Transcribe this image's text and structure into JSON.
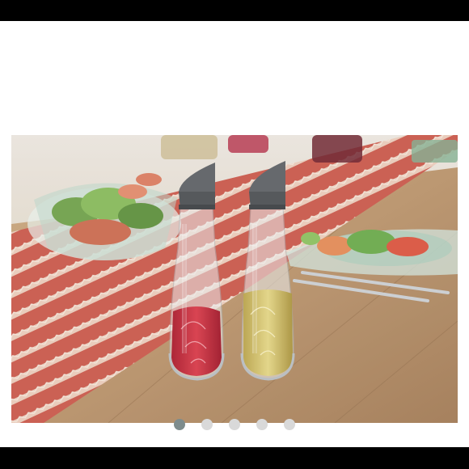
{
  "carousel": {
    "image": {
      "icon": "product-photo-oil-vinegar-cruet-set"
    },
    "slide_count": 5,
    "active_index": 0,
    "colors": {
      "active_dot": "#7e8c8d",
      "inactive_dot": "#d9d9d9",
      "bars": "#000000"
    }
  }
}
